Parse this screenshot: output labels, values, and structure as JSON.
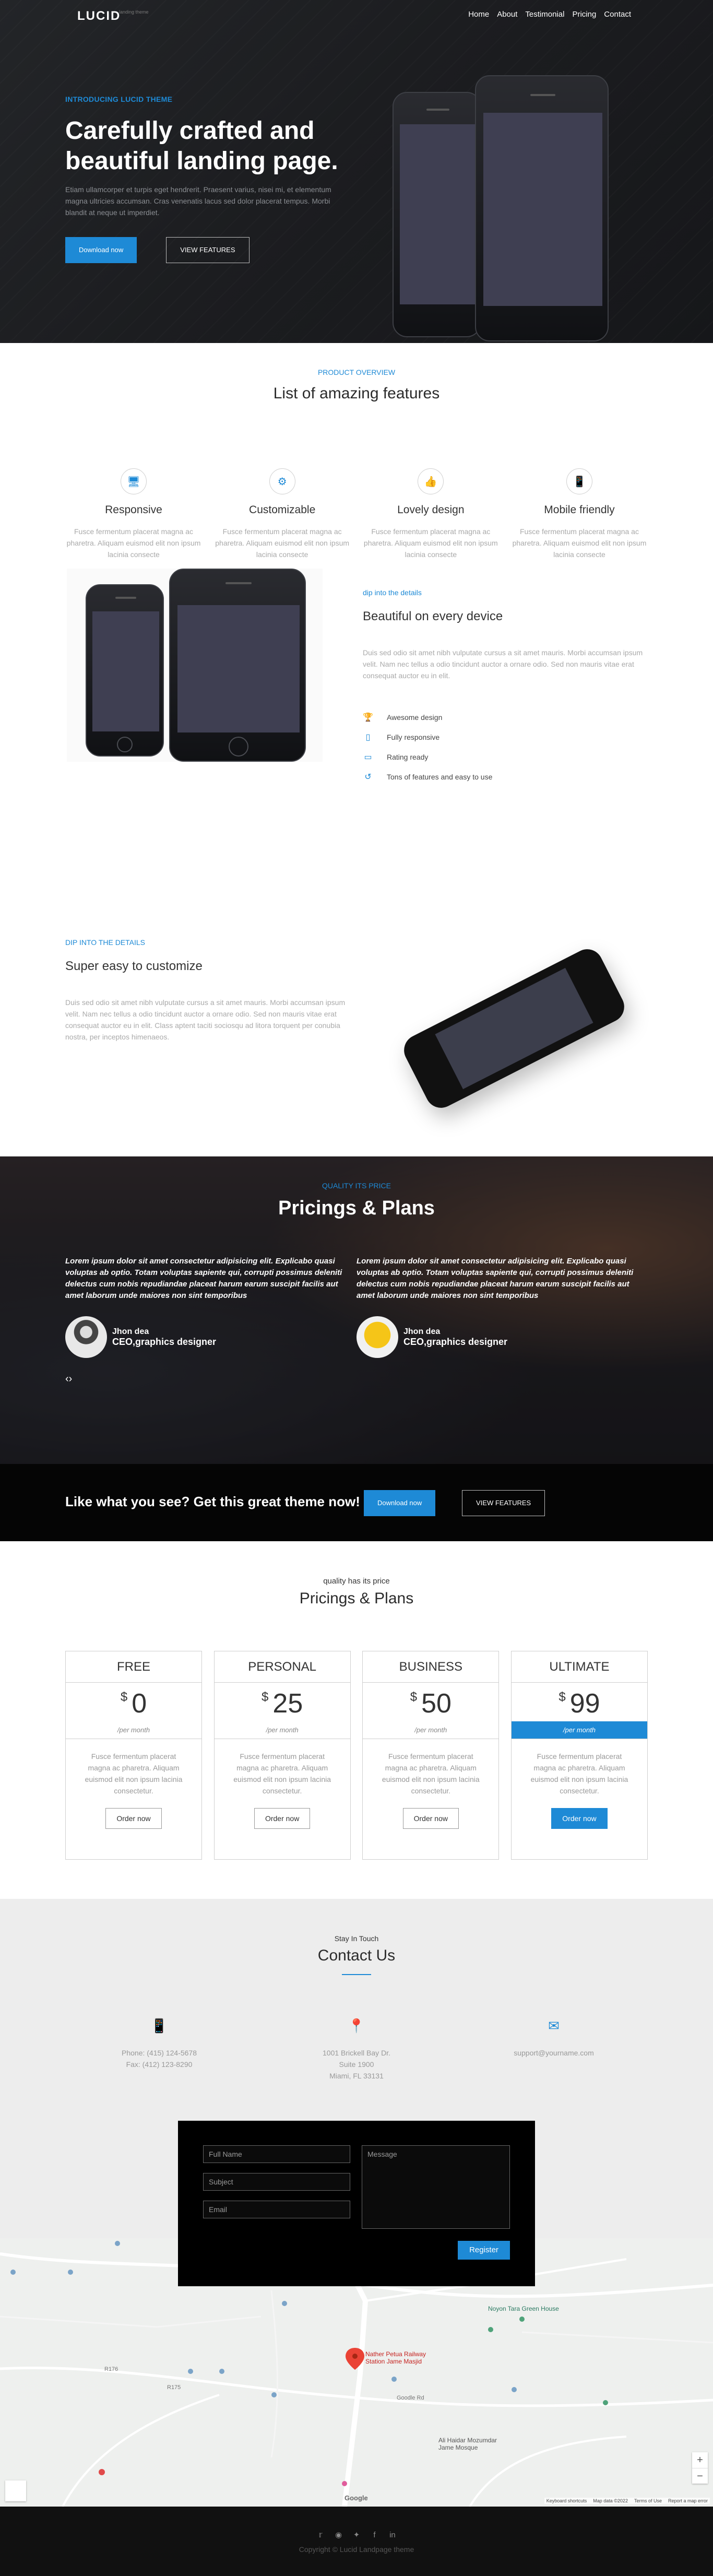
{
  "nav": {
    "logo": "LUCID",
    "logo_sub": "landing theme",
    "items": [
      "Home",
      "About",
      "Testimonial",
      "Pricing",
      "Contact"
    ]
  },
  "hero": {
    "eyebrow": "INTRODUCING LUCID THEME",
    "title_line1": "Carefully crafted and",
    "title_line2": "beautiful landing page.",
    "lead": "Etiam ullamcorper et turpis eget hendrerit. Praesent varius, nisei mi, et elementum magna ultricies accumsan. Cras venenatis lacus sed dolor placerat tempus. Morbi blandit at neque ut imperdiet.",
    "primary_button": "Download now",
    "secondary_button": "VIEW FEATURES"
  },
  "overview": {
    "eyebrow": "PRODUCT OVERVIEW",
    "title": "List of amazing features",
    "features": [
      {
        "icon": "monitor-icon",
        "title": "Responsive",
        "text": "Fusce fermentum placerat magna ac pharetra. Aliquam euismod elit non ipsum lacinia consecte"
      },
      {
        "icon": "gear-icon",
        "title": "Customizable",
        "text": "Fusce fermentum placerat magna ac pharetra. Aliquam euismod elit non ipsum lacinia consecte"
      },
      {
        "icon": "thumbs-up-icon",
        "title": "Lovely design",
        "text": "Fusce fermentum placerat magna ac pharetra. Aliquam euismod elit non ipsum lacinia consecte"
      },
      {
        "icon": "mobile-icon",
        "title": "Mobile friendly",
        "text": "Fusce fermentum placerat magna ac pharetra. Aliquam euismod elit non ipsum lacinia consecte"
      }
    ]
  },
  "detail1": {
    "eyebrow": "dip into the details",
    "title": "Beautiful on every device",
    "text": "Duis sed odio sit amet nibh vulputate cursus a sit amet mauris. Morbi accumsan ipsum velit. Nam nec tellus a odio tincidunt auctor a ornare odio. Sed non mauris vitae erat consequat auctor eu in elit.",
    "list": [
      {
        "icon": "trophy-icon",
        "label": "Awesome design"
      },
      {
        "icon": "mobile-icon",
        "label": "Fully responsive"
      },
      {
        "icon": "monitor-icon",
        "label": "Rating ready"
      },
      {
        "icon": "refresh-icon",
        "label": "Tons of features and easy to use"
      }
    ]
  },
  "detail2": {
    "eyebrow": "DIP INTO THE DETAILS",
    "title": "Super easy to customize",
    "text": "Duis sed odio sit amet nibh vulputate cursus a sit amet mauris. Morbi accumsan ipsum velit. Nam nec tellus a odio tincidunt auctor a ornare odio. Sed non mauris vitae erat consequat auctor eu in elit. Class aptent taciti sociosqu ad litora torquent per conubia nostra, per inceptos himenaeos."
  },
  "testimonial": {
    "eyebrow": "QUALITY ITS PRICE",
    "title": "Pricings & Plans",
    "quotes": [
      {
        "text": "Lorem ipsum dolor sit amet consectetur adipisicing elit. Explicabo quasi voluptas ab optio. Totam voluptas sapiente qui, corrupti possimus deleniti delectus cum nobis repudiandae placeat harum earum suscipit facilis aut amet laborum unde maiores non sint temporibus",
        "name": "Jhon dea",
        "role": "CEO,graphics designer"
      },
      {
        "text": "Lorem ipsum dolor sit amet consectetur adipisicing elit. Explicabo quasi voluptas ab optio. Totam voluptas sapiente qui, corrupti possimus deleniti delectus cum nobis repudiandae placeat harum earum suscipit facilis aut amet laborum unde maiores non sint temporibus",
        "name": "Jhon dea",
        "role": "CEO,graphics designer"
      }
    ],
    "slider_control": "‹›"
  },
  "cta": {
    "title": "Like what you see? Get this great theme now!",
    "primary_button": "Download now",
    "secondary_button": "VIEW FEATURES"
  },
  "pricing": {
    "eyebrow": "quality has its price",
    "title": "Pricings & Plans",
    "plans": [
      {
        "name": "FREE",
        "currency": "$",
        "amount": "0",
        "period": "/per month",
        "text": "Fusce fermentum placerat magna ac pharetra. Aliquam euismod elit non ipsum lacinia consectetur.",
        "button": "Order now"
      },
      {
        "name": "PERSONAL",
        "currency": "$",
        "amount": "25",
        "period": "/per month",
        "text": "Fusce fermentum placerat magna ac pharetra. Aliquam euismod elit non ipsum lacinia consectetur.",
        "button": "Order now"
      },
      {
        "name": "BUSINESS",
        "currency": "$",
        "amount": "50",
        "period": "/per month",
        "text": "Fusce fermentum placerat magna ac pharetra. Aliquam euismod elit non ipsum lacinia consectetur.",
        "button": "Order now"
      },
      {
        "name": "ULTIMATE",
        "currency": "$",
        "amount": "99",
        "period": "/per month",
        "text": "Fusce fermentum placerat magna ac pharetra. Aliquam euismod elit non ipsum lacinia consectetur.",
        "button": "Order now"
      }
    ]
  },
  "contact": {
    "eyebrow": "Stay In Touch",
    "title": "Contact Us",
    "phone_lines": [
      "Phone: (415) 124-5678",
      "Fax: (412) 123-8290"
    ],
    "address_lines": [
      "1001 Brickell Bay Dr.",
      "Suite 1900",
      "Miami, FL 33131"
    ],
    "email": "support@yourname.com",
    "form": {
      "name_placeholder": "Full Name",
      "subject_placeholder": "Subject",
      "email_placeholder": "Email",
      "message_placeholder": "Message",
      "submit": "Register"
    }
  },
  "map": {
    "labels": [
      "Noyon Tara Green House",
      "Nather Petua Railway Station Jame Masjid",
      "Ali Haidar Mozumdar Jame Mosque",
      "Goodle Rd",
      "R176",
      "R175"
    ],
    "zoom_in": "+",
    "zoom_out": "−",
    "google": "Google",
    "attribution": [
      "Keyboard shortcuts",
      "Map data ©2022",
      "Terms of Use",
      "Report a map error"
    ]
  },
  "footer": {
    "social_icons": [
      "twitter-icon",
      "github-icon",
      "twitter-icon",
      "facebook-icon",
      "linkedin-icon"
    ],
    "copyright": "Copyright © Lucid Landpage theme"
  },
  "colors": {
    "accent": "#1e8ad6",
    "dark": "#050505",
    "light_bg": "#ededed"
  }
}
